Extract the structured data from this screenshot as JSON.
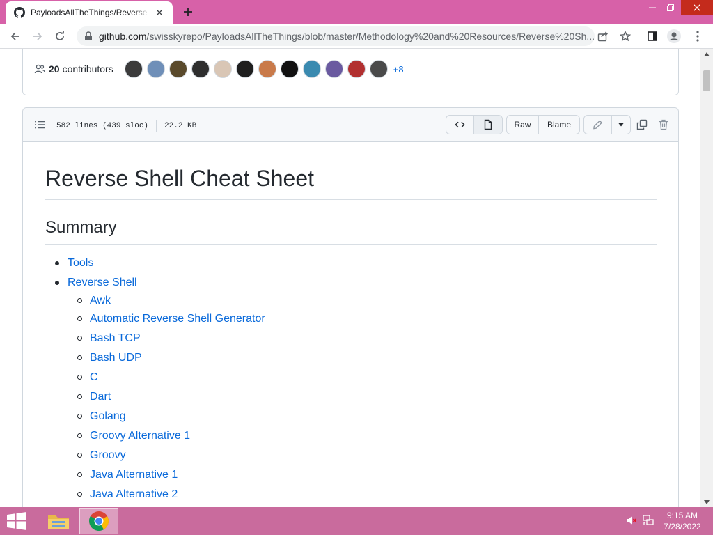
{
  "browser": {
    "tab_title": "PayloadsAllTheThings/Reverse Shell Cheatsheet.md",
    "url_host": "github.com",
    "url_path": "/swisskyrepo/PayloadsAllTheThings/blob/master/Methodology%20and%20Resources/Reverse%20Sh..."
  },
  "contributors": {
    "count": "20",
    "label": "contributors",
    "more": "+8",
    "avatars": [
      "#3b3b3b",
      "#6f8fb8",
      "#5a4a2c",
      "#2e2e2e",
      "#d9c6b5",
      "#1f1f1f",
      "#c97a4a",
      "#111111",
      "#3a8ab0",
      "#6a5aa0",
      "#b23030",
      "#4a4a4a"
    ]
  },
  "file": {
    "lines": "582 lines (439 sloc)",
    "size": "22.2 KB",
    "raw_label": "Raw",
    "blame_label": "Blame"
  },
  "markdown": {
    "h1": "Reverse Shell Cheat Sheet",
    "h2": "Summary",
    "top_items": [
      "Tools",
      "Reverse Shell"
    ],
    "sub_items": [
      "Awk",
      "Automatic Reverse Shell Generator",
      "Bash TCP",
      "Bash UDP",
      "C",
      "Dart",
      "Golang",
      "Groovy Alternative 1",
      "Groovy",
      "Java Alternative 1",
      "Java Alternative 2"
    ]
  },
  "taskbar": {
    "time": "9:15 AM",
    "date": "7/28/2022"
  },
  "colors": {
    "titlebar": "#d761a8",
    "taskbar": "#c96b9d",
    "link": "#0969da"
  }
}
